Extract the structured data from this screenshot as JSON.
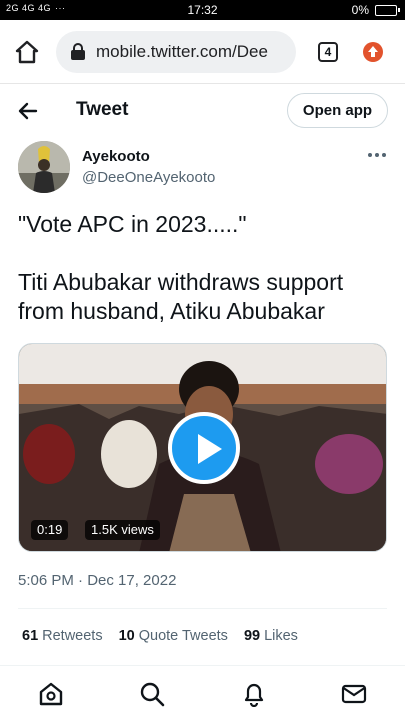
{
  "status_bar": {
    "signal_text": "2G 4G 4G",
    "time": "17:32",
    "battery": "0%"
  },
  "browser": {
    "url": "mobile.twitter.com/Dee",
    "tab_count": "4",
    "icons": [
      "home-icon",
      "lock-icon",
      "tabs-icon",
      "update-icon"
    ]
  },
  "header": {
    "title": "Tweet",
    "open_app_label": "Open app"
  },
  "author": {
    "name": "Ayekooto",
    "handle": "@DeeOneAyekooto"
  },
  "tweet": {
    "line1": "\"Vote APC in 2023.....\"",
    "line2": "Titi Abubakar withdraws support from husband, Atiku Abubakar"
  },
  "media": {
    "duration": "0:19",
    "views": "1.5K views"
  },
  "timestamp": "5:06 PM · Dec 17, 2022",
  "stats": {
    "retweets_count": "61",
    "retweets_label": "Retweets",
    "quotes_count": "10",
    "quotes_label": "Quote Tweets",
    "likes_count": "99",
    "likes_label": "Likes"
  },
  "colors": {
    "accent": "#1d9bf0",
    "text": "#0f1419",
    "secondary_text": "#536471"
  }
}
